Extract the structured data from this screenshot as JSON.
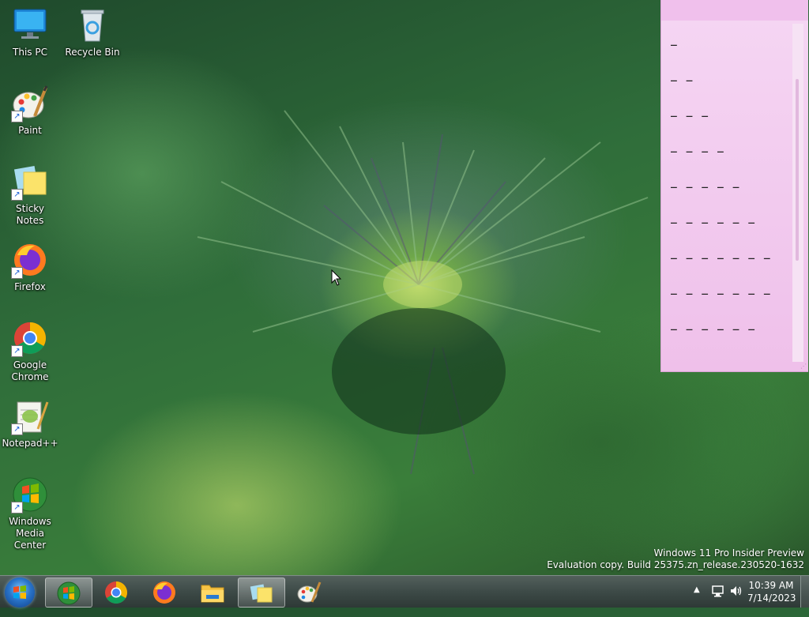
{
  "desktop": {
    "icons": [
      {
        "label": "This PC",
        "icon": "computer-icon"
      },
      {
        "label": "Recycle Bin",
        "icon": "recycle-bin-icon"
      },
      {
        "label": "Paint",
        "icon": "paint-palette-icon"
      },
      {
        "label": "Sticky Notes",
        "icon": "sticky-notes-icon"
      },
      {
        "label": "Firefox",
        "icon": "firefox-icon"
      },
      {
        "label": "Google Chrome",
        "icon": "chrome-icon"
      },
      {
        "label": "Notepad++",
        "icon": "notepadpp-icon"
      },
      {
        "label": "Windows Media Center",
        "icon": "media-center-icon"
      }
    ]
  },
  "sticky_note": {
    "lines": [
      "_",
      "_ _",
      "_ _ _",
      "_ _ _ _",
      "_ _ _ _ _",
      "_ _ _ _ _ _",
      "_ _ _ _ _ _ _",
      "_ _ _ _ _ _ _",
      "_ _ _ _ _ _"
    ],
    "bg_color": "#f2c7ef"
  },
  "watermark": {
    "line1": "Windows 11 Pro Insider Preview",
    "line2": "Evaluation copy. Build 25375.zn_release.230520-1632"
  },
  "taskbar": {
    "items": [
      {
        "name": "media-center-icon",
        "active": true
      },
      {
        "name": "chrome-icon",
        "active": false
      },
      {
        "name": "firefox-icon",
        "active": false
      },
      {
        "name": "file-explorer-icon",
        "active": false
      },
      {
        "name": "sticky-notes-icon",
        "active": true
      },
      {
        "name": "paint-palette-icon",
        "active": false
      }
    ],
    "tray": {
      "time": "10:39 AM",
      "date": "7/14/2023"
    }
  }
}
